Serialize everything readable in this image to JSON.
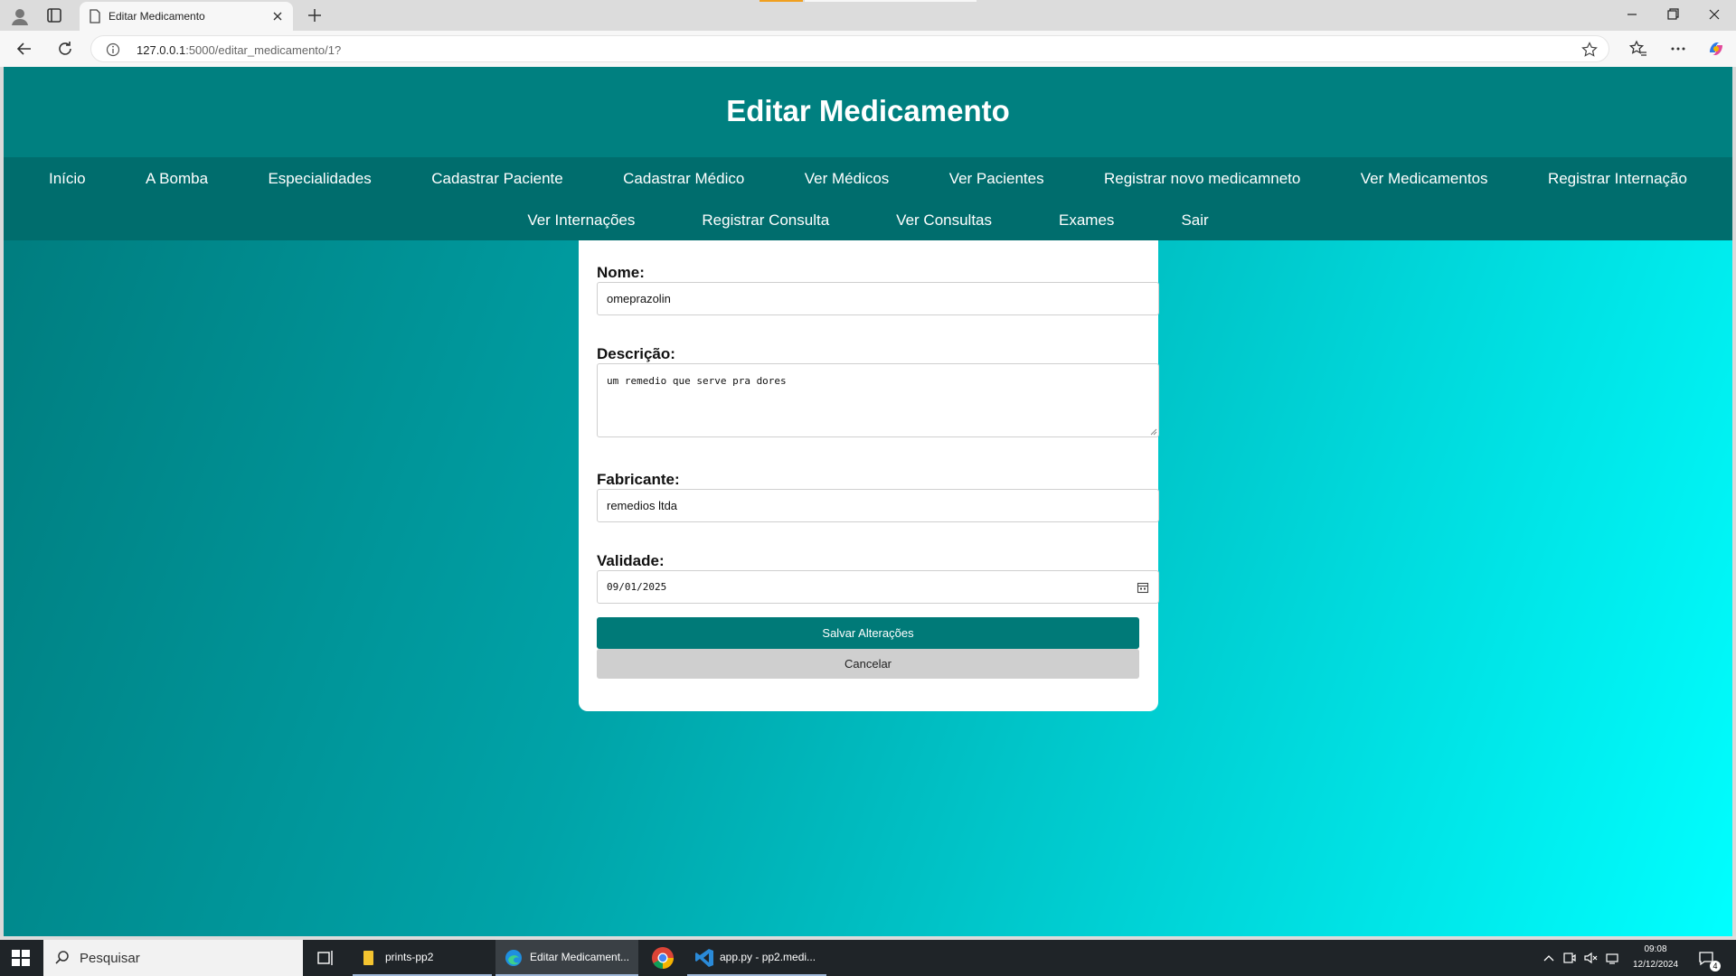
{
  "browser": {
    "tab_title": "Editar Medicamento",
    "url_host": "127.0.0.1",
    "url_rest": ":5000/editar_medicamento/1?"
  },
  "page": {
    "title": "Editar Medicamento",
    "menu_row1": [
      "Início",
      "A Bomba",
      "Especialidades",
      "Cadastrar Paciente",
      "Cadastrar Médico",
      "Ver Médicos",
      "Ver Pacientes",
      "Registrar novo medicamneto",
      "Ver Medicamentos",
      "Registrar Internação"
    ],
    "menu_row2": [
      "Ver Internações",
      "Registrar Consulta",
      "Ver Consultas",
      "Exames",
      "Sair"
    ]
  },
  "form": {
    "nome_label": "Nome:",
    "nome_value": "omeprazolin",
    "descricao_label": "Descrição:",
    "descricao_value": "um remedio que serve pra dores",
    "fabricante_label": "Fabricante:",
    "fabricante_value": "remedios ltda",
    "validade_label": "Validade:",
    "validade_value": "09/01/2025",
    "save_label": "Salvar Alterações",
    "cancel_label": "Cancelar"
  },
  "taskbar": {
    "search_placeholder": "Pesquisar",
    "items": [
      "prints-pp2",
      "Editar Medicament...",
      "app.py - pp2.medi..."
    ],
    "time": "09:08",
    "date": "12/12/2024",
    "notifications": "4"
  },
  "colors": {
    "header": "#008080",
    "menu": "#006d6d",
    "save_button": "#007a78",
    "cancel_button": "#cfcfcf"
  }
}
